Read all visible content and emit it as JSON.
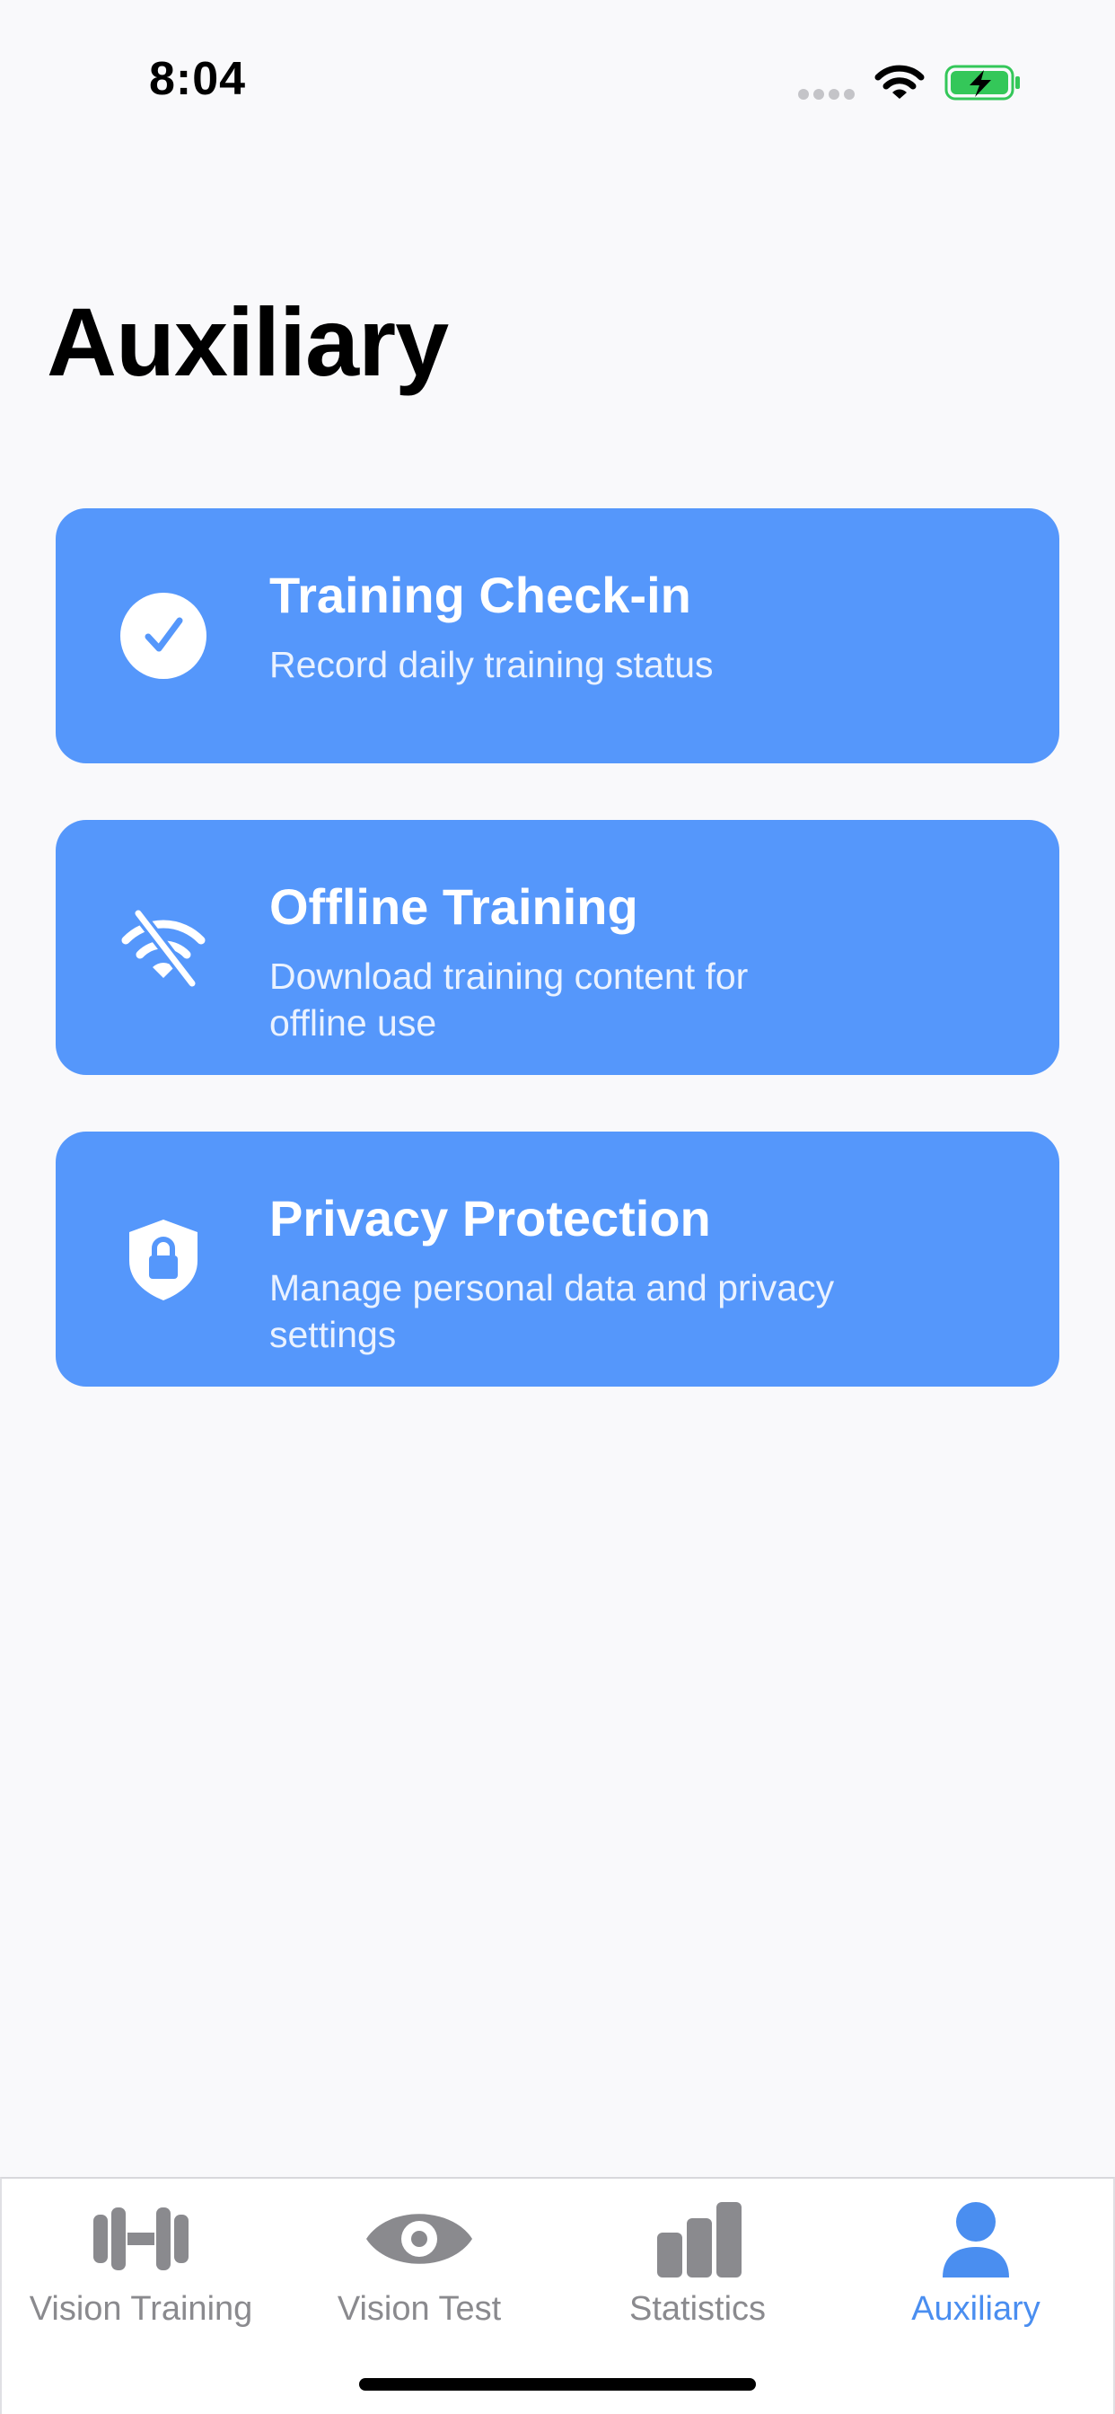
{
  "status_bar": {
    "time": "8:04"
  },
  "page": {
    "title": "Auxiliary"
  },
  "cards": [
    {
      "icon": "checkmark-circle-icon",
      "title": "Training Check-in",
      "subtitle": "Record daily training status"
    },
    {
      "icon": "wifi-slash-icon",
      "title": "Offline Training",
      "subtitle": "Download training content for offline use"
    },
    {
      "icon": "lock-shield-icon",
      "title": "Privacy Protection",
      "subtitle": "Manage personal data and privacy settings"
    }
  ],
  "tab_bar": {
    "tabs": [
      {
        "label": "Vision Training",
        "icon": "dumbbell-icon",
        "active": false
      },
      {
        "label": "Vision Test",
        "icon": "eye-icon",
        "active": false
      },
      {
        "label": "Statistics",
        "icon": "bar-chart-icon",
        "active": false
      },
      {
        "label": "Auxiliary",
        "icon": "person-icon",
        "active": true
      }
    ]
  },
  "colors": {
    "card_background": "#5597fb",
    "accent": "#4a8ef0",
    "inactive_tab": "#8a8a8e",
    "battery_green": "#34c759",
    "background": "#f9f9fb"
  }
}
